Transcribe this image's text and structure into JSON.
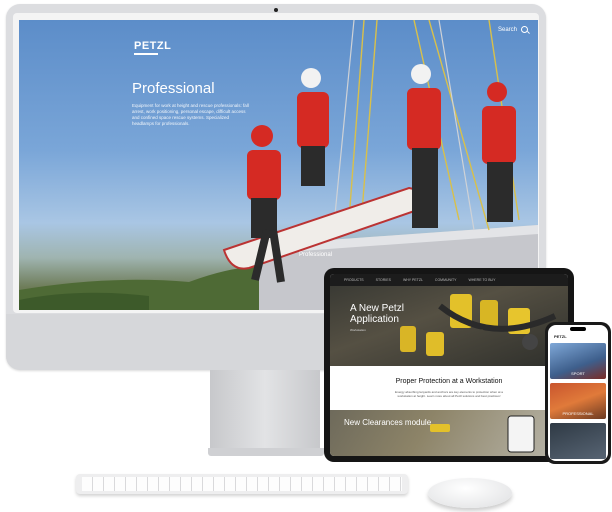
{
  "desktop": {
    "logo": "PETZL",
    "search_label": "Search",
    "hero_title": "Professional",
    "hero_description": "Equipment for work at height and rescue professionals: fall arrest, work positioning, personal escape, difficult access and confined space rescue systems. Specialized headlamps for professionals.",
    "hero_caption": "Professional"
  },
  "tablet": {
    "nav_items": [
      "PRODUCTS",
      "STORIES",
      "WHY PETZL",
      "COMMUNITY",
      "WHERE TO BUY"
    ],
    "hero_title": "A New Petzl Application",
    "hero_subtitle": "Workstation",
    "section_title": "Proper Protection at a Workstation",
    "section_description": "Energy absorbing lanyards and anchors are key elements to protection when at a workstation at height. Learn more about all Petzl solutions and best practices!",
    "card_title": "New Clearances module"
  },
  "phone": {
    "logo": "PETZL",
    "tiles": [
      "SPORT",
      "PROFESSIONAL"
    ]
  },
  "colors": {
    "sky": "#6f9fd6",
    "rescue_red": "#d52a23",
    "helmet_white": "#f2f2f2",
    "ipad_dark": "#151515"
  }
}
